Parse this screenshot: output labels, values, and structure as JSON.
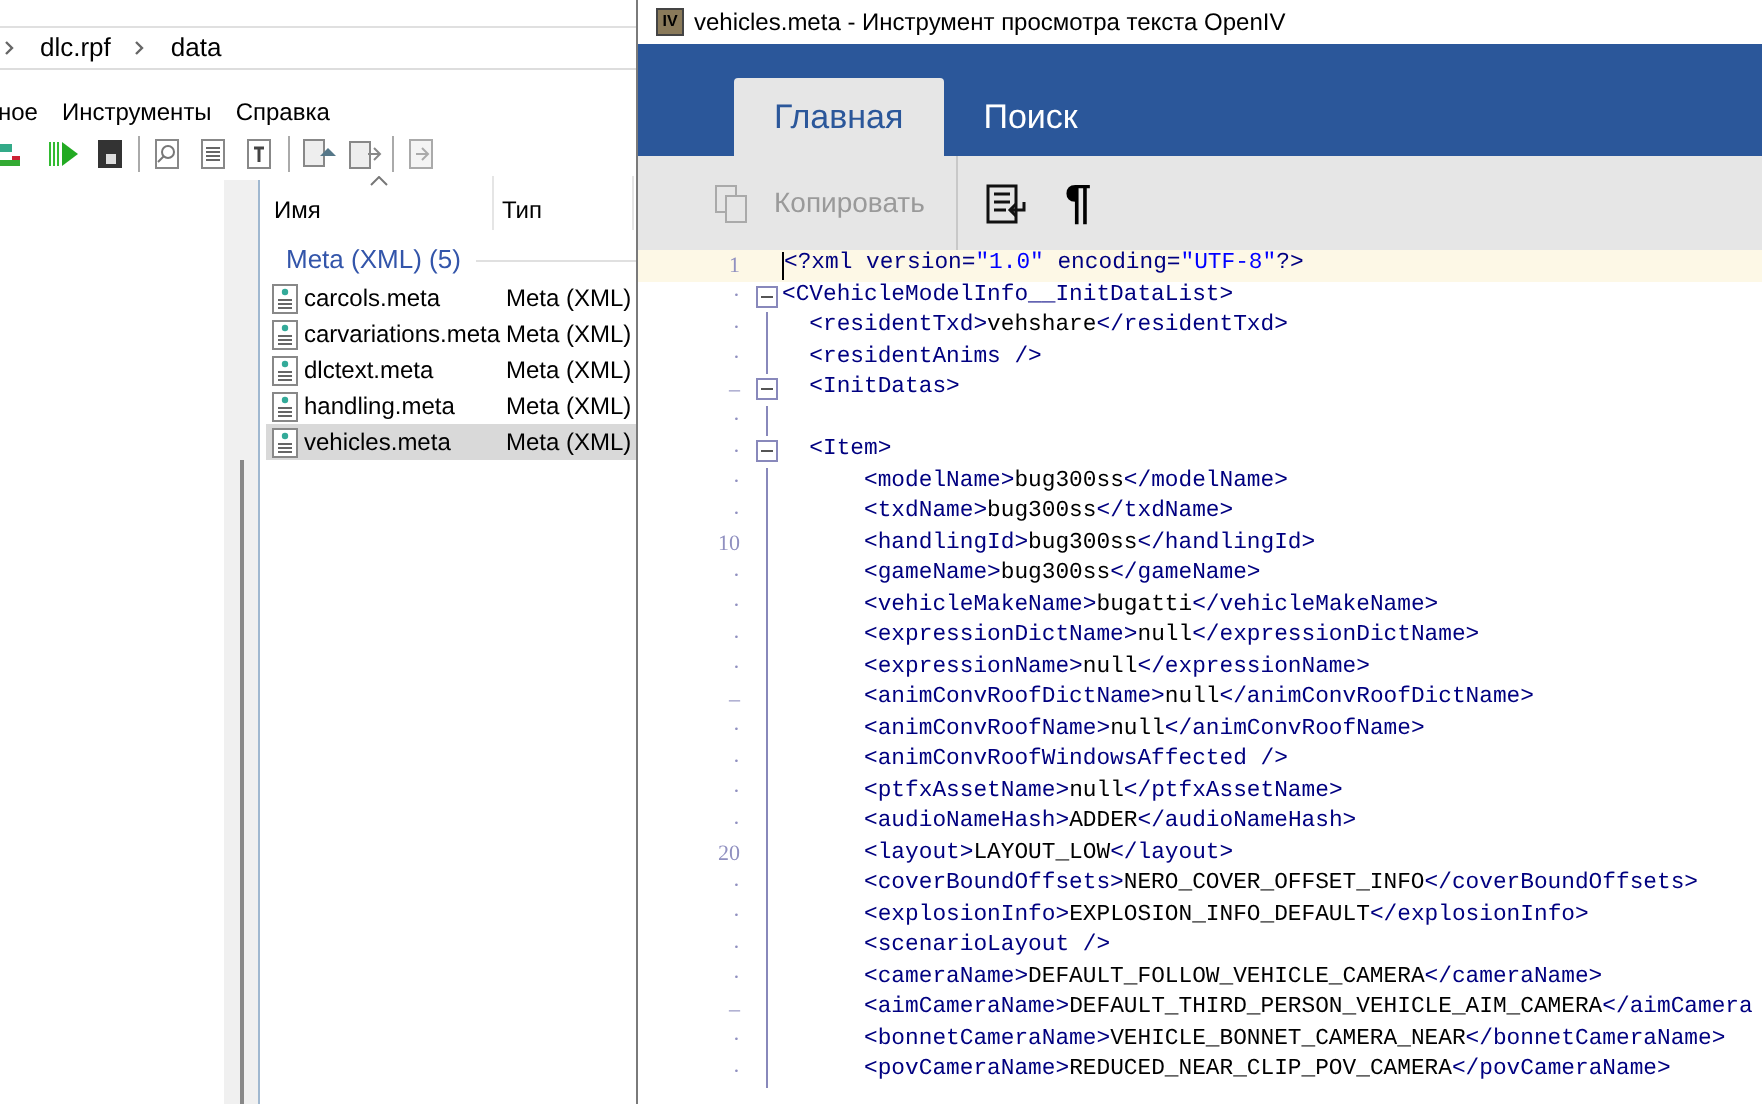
{
  "explorer": {
    "breadcrumb": [
      "dlc.rpf",
      "data"
    ],
    "menu": [
      "ное",
      "Инструменты",
      "Справка"
    ],
    "columns": [
      {
        "label": "Имя",
        "sorted": true
      },
      {
        "label": "Тип",
        "sorted": false
      }
    ],
    "group": "Meta (XML) (5)",
    "files": [
      {
        "name": "carcols.meta",
        "type": "Meta (XML)",
        "selected": false
      },
      {
        "name": "carvariations.meta",
        "type": "Meta (XML)",
        "selected": false
      },
      {
        "name": "dlctext.meta",
        "type": "Meta (XML)",
        "selected": false
      },
      {
        "name": "handling.meta",
        "type": "Meta (XML)",
        "selected": false
      },
      {
        "name": "vehicles.meta",
        "type": "Meta (XML)",
        "selected": true
      }
    ]
  },
  "viewer": {
    "app_icon": "IV",
    "title": "vehicles.meta - Инструмент просмотра текста OpenIV",
    "tabs": [
      {
        "label": "Главная",
        "selected": true
      },
      {
        "label": "Поиск",
        "selected": false
      }
    ],
    "copy_button": {
      "label": "Копировать",
      "disabled": true
    },
    "pilcrow": "¶",
    "lines": [
      {
        "gutter": "1",
        "kind": "none",
        "current": true,
        "text": "<?xml version=\"1.0\" encoding=\"UTF-8\"?>"
      },
      {
        "gutter": "·",
        "kind": "box",
        "current": false,
        "text": "<CVehicleModelInfo__InitDataList>"
      },
      {
        "gutter": "·",
        "kind": "line",
        "current": false,
        "text": "  <residentTxd>vehshare</residentTxd>"
      },
      {
        "gutter": "·",
        "kind": "line",
        "current": false,
        "text": "  <residentAnims />"
      },
      {
        "gutter": "–",
        "kind": "box",
        "current": false,
        "text": "  <InitDatas>"
      },
      {
        "gutter": "·",
        "kind": "line",
        "current": false
      },
      {
        "gutter": "·",
        "kind": "box",
        "current": false,
        "text": "  <Item>"
      },
      {
        "gutter": "·",
        "kind": "line",
        "current": false,
        "text": "      <modelName>bug300ss</modelName>"
      },
      {
        "gutter": "·",
        "kind": "line",
        "current": false,
        "text": "      <txdName>bug300ss</txdName>"
      },
      {
        "gutter": "10",
        "kind": "line",
        "current": false,
        "text": "      <handlingId>bug300ss</handlingId>"
      },
      {
        "gutter": "·",
        "kind": "line",
        "current": false,
        "text": "      <gameName>bug300ss</gameName>"
      },
      {
        "gutter": "·",
        "kind": "line",
        "current": false,
        "text": "      <vehicleMakeName>bugatti</vehicleMakeName>"
      },
      {
        "gutter": "·",
        "kind": "line",
        "current": false,
        "text": "      <expressionDictName>null</expressionDictName>"
      },
      {
        "gutter": "·",
        "kind": "line",
        "current": false,
        "text": "      <expressionName>null</expressionName>"
      },
      {
        "gutter": "–",
        "kind": "line",
        "current": false,
        "text": "      <animConvRoofDictName>null</animConvRoofDictName>"
      },
      {
        "gutter": "·",
        "kind": "line",
        "current": false,
        "text": "      <animConvRoofName>null</animConvRoofName>"
      },
      {
        "gutter": "·",
        "kind": "line",
        "current": false,
        "text": "      <animConvRoofWindowsAffected />"
      },
      {
        "gutter": "·",
        "kind": "line",
        "current": false,
        "text": "      <ptfxAssetName>null</ptfxAssetName>"
      },
      {
        "gutter": "·",
        "kind": "line",
        "current": false,
        "text": "      <audioNameHash>ADDER</audioNameHash>"
      },
      {
        "gutter": "20",
        "kind": "line",
        "current": false,
        "text": "      <layout>LAYOUT_LOW</layout>"
      },
      {
        "gutter": "·",
        "kind": "line",
        "current": false,
        "text": "      <coverBoundOffsets>NERO_COVER_OFFSET_INFO</coverBoundOffsets>"
      },
      {
        "gutter": "·",
        "kind": "line",
        "current": false,
        "text": "      <explosionInfo>EXPLOSION_INFO_DEFAULT</explosionInfo>"
      },
      {
        "gutter": "·",
        "kind": "line",
        "current": false,
        "text": "      <scenarioLayout />"
      },
      {
        "gutter": "·",
        "kind": "line",
        "current": false,
        "text": "      <cameraName>DEFAULT_FOLLOW_VEHICLE_CAMERA</cameraName>"
      },
      {
        "gutter": "–",
        "kind": "line",
        "current": false,
        "text": "      <aimCameraName>DEFAULT_THIRD_PERSON_VEHICLE_AIM_CAMERA</aimCamera"
      },
      {
        "gutter": "·",
        "kind": "line",
        "current": false,
        "text": "      <bonnetCameraName>VEHICLE_BONNET_CAMERA_NEAR</bonnetCameraName>"
      },
      {
        "gutter": "·",
        "kind": "line",
        "current": false,
        "text": "      <povCameraName>REDUCED_NEAR_CLIP_POV_CAMERA</povCameraName>"
      }
    ]
  }
}
